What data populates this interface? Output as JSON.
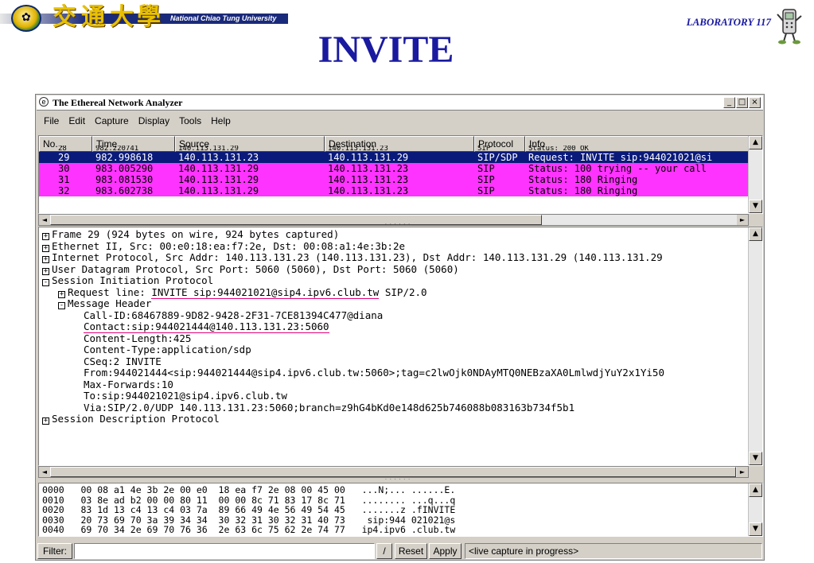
{
  "slide": {
    "title": "INVITE",
    "lab": "LABORATORY 117",
    "university": "National Chiao Tung University",
    "logo_glyphs": [
      "交",
      "通",
      "大",
      "學"
    ]
  },
  "window": {
    "title": "The Ethereal Network Analyzer",
    "buttons": [
      "_",
      "□",
      "×"
    ],
    "menu": [
      "File",
      "Edit",
      "Capture",
      "Display",
      "Tools",
      "Help"
    ]
  },
  "packet_list": {
    "columns": [
      "No. .",
      "Time",
      "Source",
      "Destination",
      "Protocol",
      "Info"
    ],
    "rows": [
      {
        "no": "28",
        "time": "982.220741",
        "src": "140.113.131.29",
        "dst": "140.113.131.23",
        "proto": "SIP",
        "info": "Status: 200 OK",
        "style": "partial"
      },
      {
        "no": "29",
        "time": "982.998618",
        "src": "140.113.131.23",
        "dst": "140.113.131.29",
        "proto": "SIP/SDP",
        "info": "Request: INVITE sip:944021021@si",
        "style": "sel"
      },
      {
        "no": "30",
        "time": "983.005290",
        "src": "140.113.131.29",
        "dst": "140.113.131.23",
        "proto": "SIP",
        "info": "Status: 100 trying -- your call",
        "style": "pink"
      },
      {
        "no": "31",
        "time": "983.081530",
        "src": "140.113.131.29",
        "dst": "140.113.131.23",
        "proto": "SIP",
        "info": "Status: 180 Ringing",
        "style": "pink"
      },
      {
        "no": "32",
        "time": "983.602738",
        "src": "140.113.131.29",
        "dst": "140.113.131.23",
        "proto": "SIP",
        "info": "Status: 180 Ringing",
        "style": "pink"
      }
    ]
  },
  "detail": {
    "lines": [
      {
        "tog": "+",
        "indent": 0,
        "text": "Frame 29 (924 bytes on wire, 924 bytes captured)"
      },
      {
        "tog": "+",
        "indent": 0,
        "text": "Ethernet II, Src: 00:e0:18:ea:f7:2e, Dst: 00:08:a1:4e:3b:2e"
      },
      {
        "tog": "+",
        "indent": 0,
        "text": "Internet Protocol, Src Addr: 140.113.131.23 (140.113.131.23), Dst Addr: 140.113.131.29 (140.113.131.29"
      },
      {
        "tog": "+",
        "indent": 0,
        "text": "User Datagram Protocol, Src Port: 5060 (5060), Dst Port: 5060 (5060)"
      },
      {
        "tog": "-",
        "indent": 0,
        "text": "Session Initiation Protocol"
      },
      {
        "tog": "+",
        "indent": 1,
        "pre": "Request line: ",
        "u": "INVITE sip:944021021@sip4.ipv6.club.tw",
        "text": " SIP/2.0"
      },
      {
        "tog": "-",
        "indent": 1,
        "text": "Message Header"
      },
      {
        "tog": "",
        "indent": 2,
        "text": "Call-ID:68467889-9D82-9428-2F31-7CE81394C477@diana"
      },
      {
        "tog": "",
        "indent": 2,
        "u": "Contact:sip:944021444@140.113.131.23:5060",
        "text": ""
      },
      {
        "tog": "",
        "indent": 2,
        "text": "Content-Length:425"
      },
      {
        "tog": "",
        "indent": 2,
        "text": "Content-Type:application/sdp"
      },
      {
        "tog": "",
        "indent": 2,
        "text": "CSeq:2 INVITE"
      },
      {
        "tog": "",
        "indent": 2,
        "text": "From:944021444<sip:944021444@sip4.ipv6.club.tw:5060>;tag=c2lwOjk0NDAyMTQ0NEBzaXA0LmlwdjYuY2x1Yi50"
      },
      {
        "tog": "",
        "indent": 2,
        "text": "Max-Forwards:10"
      },
      {
        "tog": "",
        "indent": 2,
        "text": "To:sip:944021021@sip4.ipv6.club.tw"
      },
      {
        "tog": "",
        "indent": 2,
        "text": "Via:SIP/2.0/UDP  140.113.131.23:5060;branch=z9hG4bKd0e148d625b746088b083163b734f5b1"
      },
      {
        "tog": "+",
        "indent": 0,
        "text": "Session Description Protocol"
      }
    ]
  },
  "hex": {
    "lines": [
      "0000   00 08 a1 4e 3b 2e 00 e0  18 ea f7 2e 08 00 45 00   ...N;... ......E.",
      "0010   03 8e ad b2 00 00 80 11  00 00 8c 71 83 17 8c 71   ........ ...q...q",
      "0020   83 1d 13 c4 13 c4 03 7a  89 66 49 4e 56 49 54 45   .......z .fINVITE",
      "0030   20 73 69 70 3a 39 34 34  30 32 31 30 32 31 40 73    sip:944 021021@s",
      "0040   69 70 34 2e 69 70 76 36  2e 63 6c 75 62 2e 74 77   ip4.ipv6 .club.tw"
    ]
  },
  "filter": {
    "label": "Filter:",
    "value": "",
    "clear": "/",
    "reset": "Reset",
    "apply": "Apply",
    "status": "<live capture in progress>"
  }
}
